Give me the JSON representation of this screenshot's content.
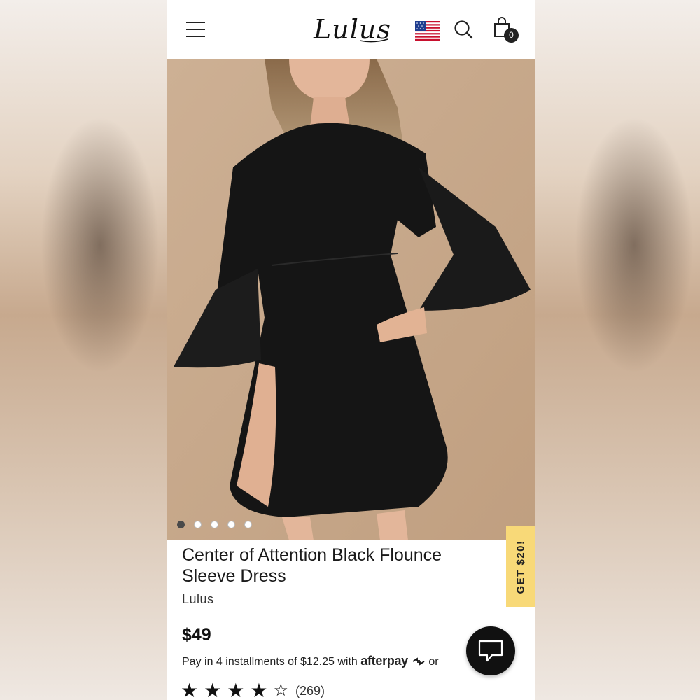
{
  "header": {
    "logo_text": "Lulus",
    "cart_count": "0",
    "icons": [
      "menu-icon",
      "us-flag-icon",
      "search-icon",
      "shopping-bag-icon"
    ]
  },
  "gallery": {
    "image_count": 5,
    "active_index": 0
  },
  "promo_tab": {
    "label": "GET $20!",
    "color": "#f8d978"
  },
  "product": {
    "title": "Center of Attention Black Flounce Sleeve Dress",
    "brand": "Lulus",
    "price": "$49",
    "installments_text": "Pay in 4 installments of $12.25 with",
    "afterpay_label": "afterpay",
    "or_text": "or",
    "rating": 4.5,
    "review_count": "(269)"
  },
  "chat": {
    "icon": "chat-icon"
  }
}
